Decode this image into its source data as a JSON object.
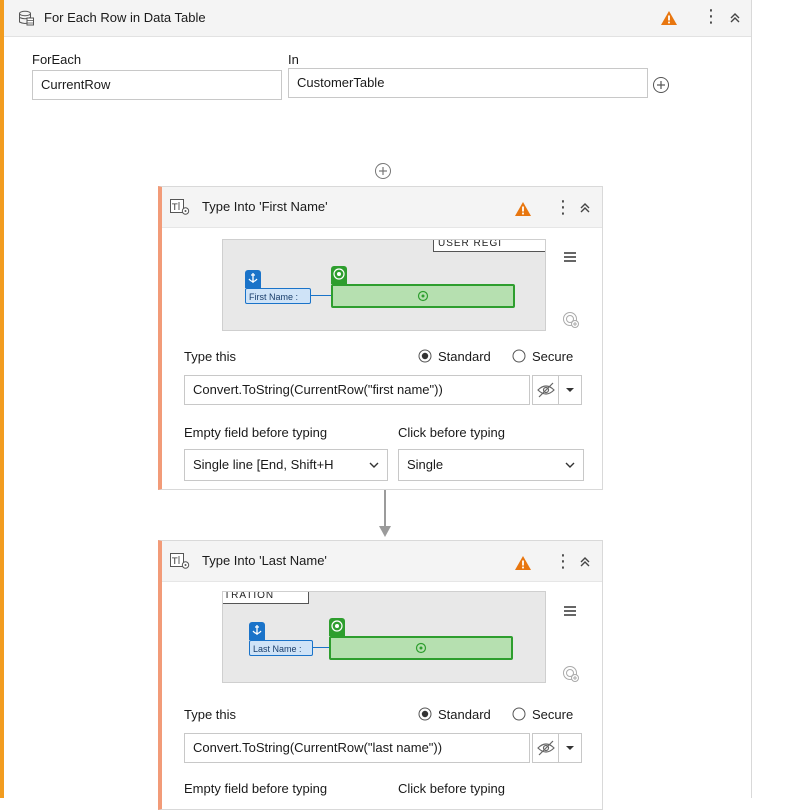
{
  "activity": {
    "title": "For Each Row in Data Table",
    "foreach_label": "ForEach",
    "foreach_value": "CurrentRow",
    "in_label": "In",
    "in_value": "CustomerTable"
  },
  "cards": [
    {
      "title": "Type Into 'First Name'",
      "preview_anchor_label": "First Name :",
      "preview_banner": "USER REGI",
      "type_this_label": "Type this",
      "radio_standard": "Standard",
      "radio_secure": "Secure",
      "type_value": "Convert.ToString(CurrentRow(\"first name\"))",
      "empty_field_label": "Empty field before typing",
      "empty_field_value": "Single line [End, Shift+H",
      "click_before_label": "Click before typing",
      "click_before_value": "Single"
    },
    {
      "title": "Type Into 'Last Name'",
      "preview_anchor_label": "Last Name :",
      "preview_banner": "TRATION",
      "type_this_label": "Type this",
      "radio_standard": "Standard",
      "radio_secure": "Secure",
      "type_value": "Convert.ToString(CurrentRow(\"last name\"))",
      "empty_field_label": "Empty field before typing",
      "click_before_label": "Click before typing"
    }
  ],
  "colors": {
    "accent_orange": "#f29c1f",
    "card_border": "#f29b78",
    "warning": "#e8760f",
    "target_green": "#2e9e2e",
    "anchor_blue": "#1a73c9"
  },
  "icons": {
    "activity": "data-table-icon",
    "type_into": "type-into-icon",
    "warning": "warning-icon",
    "menu": "kebab-menu-icon",
    "collapse": "collapse-chevrons-icon",
    "add": "circle-plus-icon",
    "hide": "eye-slash-icon"
  }
}
